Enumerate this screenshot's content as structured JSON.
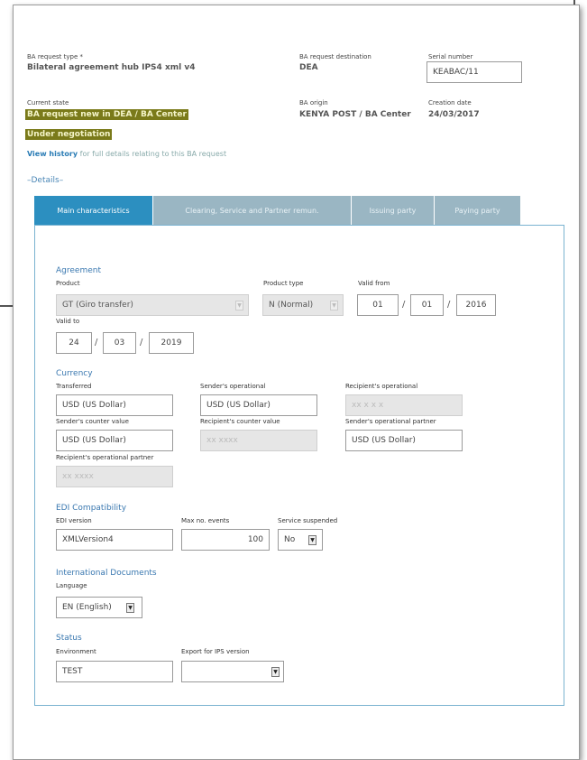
{
  "header": {
    "request_type_label": "BA request type *",
    "request_type_value": "Bilateral agreement hub IPS4 xml v4",
    "destination_label": "BA request destination",
    "destination_value": "DEA",
    "serial_label": "Serial number",
    "serial_value": "KEABAC/11",
    "current_state_label": "Current state",
    "current_state_line1": "BA request new in DEA / BA Center",
    "current_state_line2": "Under negotiation",
    "origin_label": "BA origin",
    "origin_value": "KENYA POST / BA Center",
    "creation_label": "Creation date",
    "creation_value": "24/03/2017",
    "history_link": "View history",
    "history_rest": "for full details relating to this BA request"
  },
  "details_label": "–Details–",
  "tabs": [
    "Main characteristics",
    "Clearing, Service and Partner remun.",
    "Issuing party",
    "Paying party"
  ],
  "agreement": {
    "section": "Agreement",
    "product_label": "Product",
    "product_value": "GT (Giro transfer)",
    "product_type_label": "Product type",
    "product_type_value": "N (Normal)",
    "valid_from_label": "Valid from",
    "valid_from": [
      "01",
      "01",
      "2016"
    ],
    "valid_to_label": "Valid to",
    "valid_to": [
      "24",
      "03",
      "2019"
    ]
  },
  "currency": {
    "section": "Currency",
    "transferred_label": "Transferred",
    "transferred_value": "USD (US Dollar)",
    "senders_operational_label": "Sender's operational",
    "senders_operational_value": "USD (US Dollar)",
    "recipients_operational_label": "Recipient's operational",
    "recipients_operational_value": "xx  x x x",
    "senders_counter_label": "Sender's counter value",
    "senders_counter_value": "USD (US Dollar)",
    "recipients_counter_label": "Recipient's counter value",
    "recipients_counter_value": "xx  xxxx",
    "senders_partner_label": "Sender's operational partner",
    "senders_partner_value": "USD (US Dollar)",
    "recipients_partner_label": "Recipient's operational partner",
    "recipients_partner_value": "xx  xxxx"
  },
  "edi": {
    "section": "EDI Compatibility",
    "version_label": "EDI version",
    "version_value": "XMLVersion4",
    "max_events_label": "Max no. events",
    "max_events_value": "100",
    "suspended_label": "Service suspended",
    "suspended_value": "No"
  },
  "intl_docs": {
    "section": "International Documents",
    "language_label": "Language",
    "language_value": "EN (English)"
  },
  "status": {
    "section": "Status",
    "environment_label": "Environment",
    "environment_value": "TEST",
    "export_label": "Export for IPS version",
    "export_value": ""
  },
  "icons": {
    "dropdown": "chevron-down-icon"
  }
}
